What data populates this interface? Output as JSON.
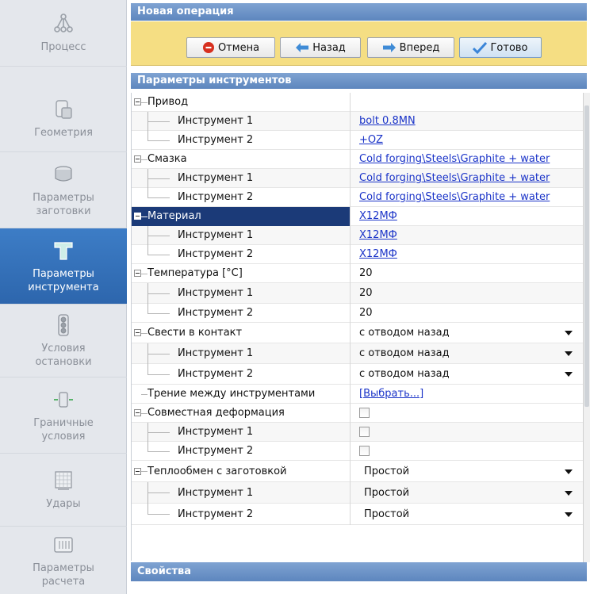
{
  "sidebar": {
    "items": [
      {
        "label": "Процесс",
        "icon": "process-icon",
        "active": false
      },
      {
        "label": "Геометрия",
        "icon": "geometry-icon",
        "active": false
      },
      {
        "label": "Параметры\nзаготовки",
        "icon": "workpiece-icon",
        "active": false
      },
      {
        "label": "Параметры\nинструмента",
        "icon": "tool-icon",
        "active": true
      },
      {
        "label": "Условия\nостановки",
        "icon": "stop-conditions-icon",
        "active": false
      },
      {
        "label": "Граничные\nусловия",
        "icon": "boundary-conditions-icon",
        "active": false
      },
      {
        "label": "Удары",
        "icon": "blows-icon",
        "active": false
      },
      {
        "label": "Параметры\nрасчета",
        "icon": "calc-params-icon",
        "active": false
      }
    ]
  },
  "header": {
    "title": "Новая операция"
  },
  "toolbar": {
    "cancel_label": "Отмена",
    "back_label": "Назад",
    "forward_label": "Вперед",
    "done_label": "Готово"
  },
  "sections": {
    "tool_params": "Параметры инструментов",
    "properties": "Свойства"
  },
  "grid": {
    "rows": [
      {
        "name": "Привод",
        "value": ""
      },
      {
        "name": "Инструмент 1",
        "value": "bolt 0.8MN"
      },
      {
        "name": "Инструмент 2",
        "value": "+OZ"
      },
      {
        "name": "Смазка",
        "value": "Cold forging\\Steels\\Graphite + water"
      },
      {
        "name": "Инструмент 1",
        "value": "Cold forging\\Steels\\Graphite + water"
      },
      {
        "name": "Инструмент 2",
        "value": "Cold forging\\Steels\\Graphite + water"
      },
      {
        "name": "Материал",
        "value": "Х12МФ"
      },
      {
        "name": "Инструмент 1",
        "value": "Х12МФ"
      },
      {
        "name": "Инструмент 2",
        "value": "Х12МФ"
      },
      {
        "name": "Температура [°C]",
        "value": "20"
      },
      {
        "name": "Инструмент 1",
        "value": "20"
      },
      {
        "name": "Инструмент 2",
        "value": "20"
      },
      {
        "name": "Свести в контакт",
        "value": "с отводом назад"
      },
      {
        "name": "Инструмент 1",
        "value": "с отводом назад"
      },
      {
        "name": "Инструмент 2",
        "value": "с отводом назад"
      },
      {
        "name": "Трение между инструментами",
        "value": "[Выбрать...]"
      },
      {
        "name": "Совместная деформация",
        "value": ""
      },
      {
        "name": "Инструмент 1",
        "value": ""
      },
      {
        "name": "Инструмент 2",
        "value": ""
      },
      {
        "name": "Теплообмен с заготовкой",
        "value": "Простой"
      },
      {
        "name": "Инструмент 1",
        "value": "Простой"
      },
      {
        "name": "Инструмент 2",
        "value": "Простой"
      }
    ]
  },
  "colors": {
    "header_blue": "#5d86be",
    "toolbar_yellow": "#f5de83",
    "sidebar_active": "#2d66ad",
    "selected_row": "#1b3a78",
    "link": "#1a33c8"
  }
}
